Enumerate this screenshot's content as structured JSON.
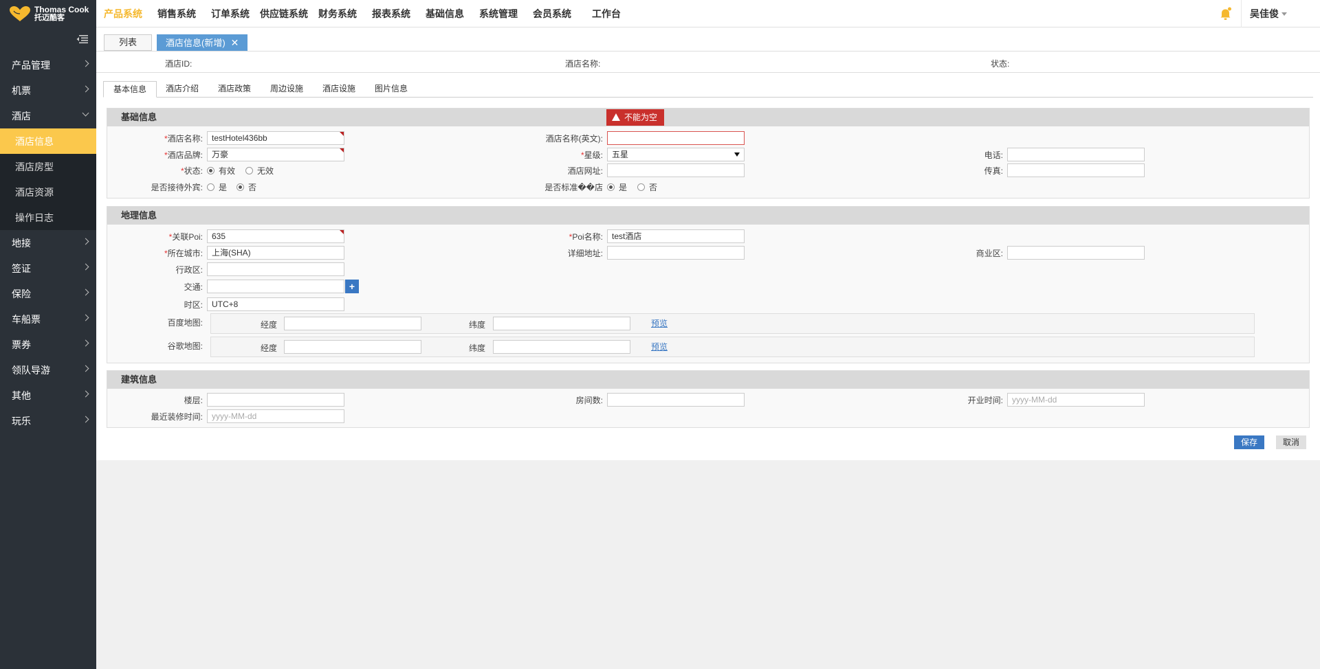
{
  "brand": {
    "name_en": "Thomas Cook",
    "name_cn": "托迈酷客"
  },
  "topnav": [
    "产品系统",
    "销售系统",
    "订单系统",
    "供应链系统",
    "财务系统",
    "报表系统",
    "基础信息",
    "系统管理",
    "会员系统",
    "工作台"
  ],
  "topnav_active": "产品系统",
  "user": {
    "name": "吴佳俊"
  },
  "sidebar": {
    "items": [
      {
        "label": "产品管理"
      },
      {
        "label": "机票"
      },
      {
        "label": "酒店",
        "open": true,
        "children": [
          "酒店信息",
          "酒店房型",
          "酒店资源",
          "操作日志"
        ],
        "active_child": "酒店信息"
      },
      {
        "label": "地接"
      },
      {
        "label": "签证"
      },
      {
        "label": "保险"
      },
      {
        "label": "车船票"
      },
      {
        "label": "票券"
      },
      {
        "label": "领队导游"
      },
      {
        "label": "其他"
      },
      {
        "label": "玩乐"
      }
    ]
  },
  "page_tabs": [
    {
      "label": "列表"
    },
    {
      "label": "酒店信息(新增)",
      "active": true,
      "closable": true
    }
  ],
  "summary": {
    "hotel_id_label": "酒店ID:",
    "hotel_name_label": "酒店名称:",
    "status_label": "状态:"
  },
  "sub_tabs": [
    "基本信息",
    "酒店介绍",
    "酒店政策",
    "周边设施",
    "酒店设施",
    "图片信息"
  ],
  "sub_tab_active": "基本信息",
  "basic": {
    "title": "基础信息",
    "error_tip": "不能为空",
    "name_label": "酒店名称:",
    "name_value": "testHotel436bb",
    "name_en_label": "酒店名称(英文):",
    "name_en_value": "",
    "brand_label": "酒店品牌:",
    "brand_value": "万豪",
    "star_label": "星级:",
    "star_value": "五星",
    "phone_label": "电话:",
    "status_label": "状态:",
    "status_options": [
      "有效",
      "无效"
    ],
    "status_selected": "有效",
    "website_label": "酒店网址:",
    "fax_label": "传真:",
    "foreign_label": "是否接待外宾:",
    "foreign_options": [
      "是",
      "否"
    ],
    "foreign_selected": "否",
    "standard_label": "是否标准��店",
    "standard_options": [
      "是",
      "否"
    ],
    "standard_selected": "是"
  },
  "geo": {
    "title": "地理信息",
    "poi_label": "关联Poi:",
    "poi_value": "635",
    "poi_name_label": "Poi名称:",
    "poi_name_value": "test酒店",
    "city_label": "所在城市:",
    "city_value": "上海(SHA)",
    "address_label": "详细地址:",
    "business_label": "商业区:",
    "district_label": "行政区:",
    "traffic_label": "交通:",
    "add_button": "+",
    "timezone_label": "时区:",
    "timezone_value": "UTC+8",
    "baidu_label": "百度地图:",
    "google_label": "谷歌地图:",
    "lng_label": "经度",
    "lat_label": "纬度",
    "preview_link": "预览"
  },
  "building": {
    "title": "建筑信息",
    "floor_label": "楼层:",
    "rooms_label": "房间数:",
    "opening_label": "开业时间:",
    "opening_placeholder": "yyyy-MM-dd",
    "renovation_label": "最近装修时间:",
    "renovation_placeholder": "yyyy-MM-dd"
  },
  "actions": {
    "save": "保存",
    "cancel": "取消"
  },
  "colors": {
    "accent": "#f5b82e",
    "sidebar_bg": "#2b3138",
    "sidebar_active": "#fbc84c",
    "primary": "#3a78c3",
    "error": "#c9302c"
  }
}
